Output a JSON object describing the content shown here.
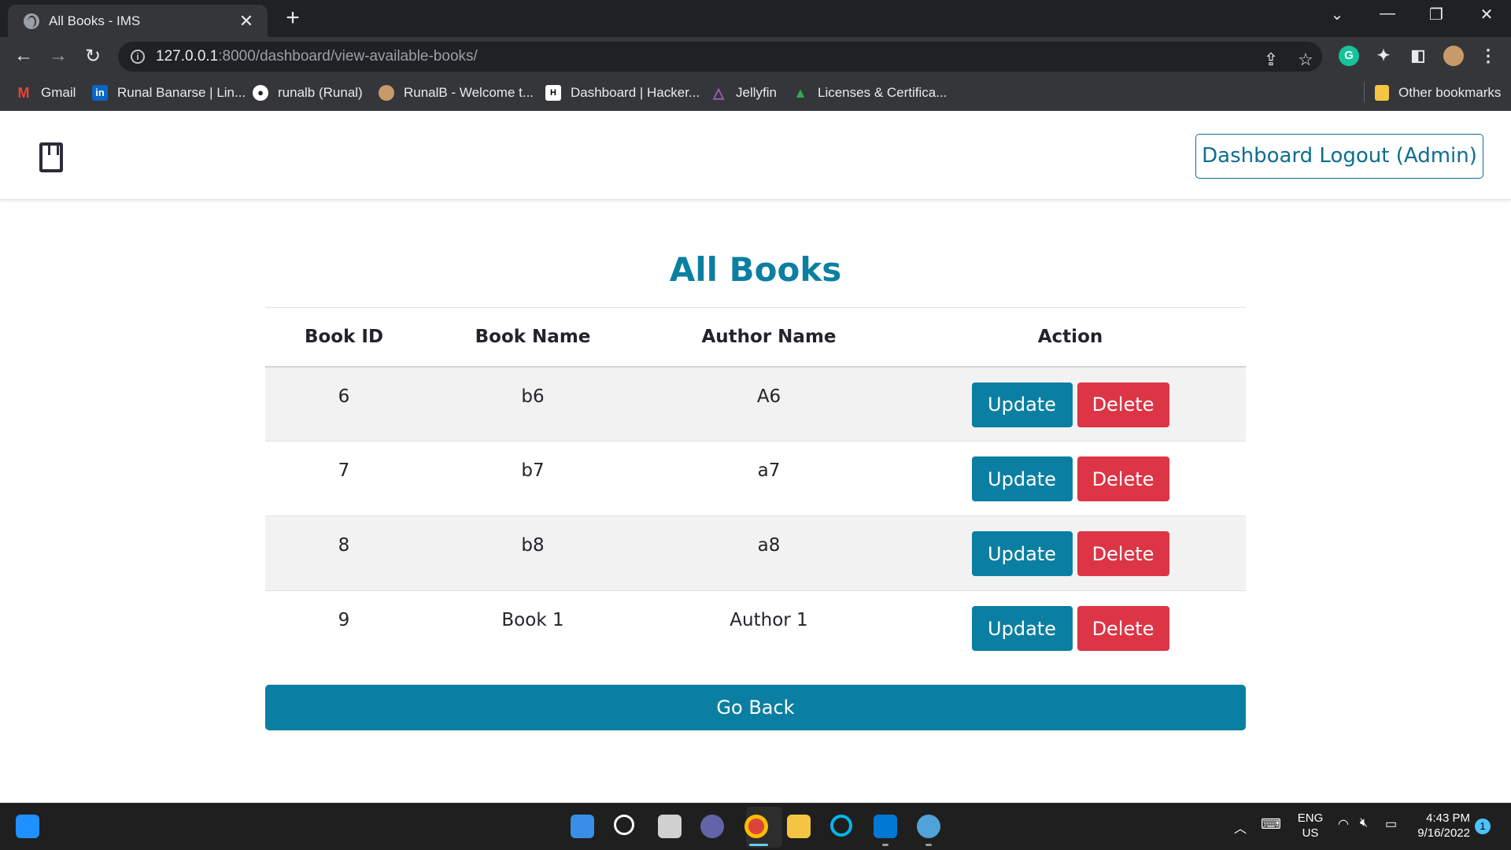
{
  "browser": {
    "tab_title": "All Books - IMS",
    "close_glyph": "✕",
    "new_tab_glyph": "+",
    "url_host": "127.0.0.1",
    "url_path": ":8000/dashboard/view-available-books/",
    "bookmarks": [
      {
        "label": "Gmail",
        "icon": "gmail-icon",
        "color": "#ea4335"
      },
      {
        "label": "Runal Banarse | Lin...",
        "icon": "linkedin-icon",
        "color": "#0a66c2"
      },
      {
        "label": "runalb (Runal)",
        "icon": "github-icon",
        "color": "#ffffff"
      },
      {
        "label": "RunalB - Welcome t...",
        "icon": "avatar-icon",
        "color": "#c89a6a"
      },
      {
        "label": "Dashboard | Hacker...",
        "icon": "hackerrank-icon",
        "color": "#ffffff"
      },
      {
        "label": "Jellyfin",
        "icon": "jellyfin-icon",
        "color": "#aa5cc3"
      },
      {
        "label": "Licenses & Certifica...",
        "icon": "google-drive-icon",
        "color": "#34a853"
      }
    ],
    "other_bookmarks": "Other bookmarks"
  },
  "page": {
    "logout_label": "Dashboard Logout (Admin)",
    "title": "All Books",
    "columns": [
      "Book ID",
      "Book Name",
      "Author Name",
      "Action"
    ],
    "rows": [
      {
        "id": "6",
        "name": "b6",
        "author": "A6"
      },
      {
        "id": "7",
        "name": "b7",
        "author": "a7"
      },
      {
        "id": "8",
        "name": "b8",
        "author": "a8"
      },
      {
        "id": "9",
        "name": "Book 1",
        "author": "Author 1"
      }
    ],
    "update_label": "Update",
    "delete_label": "Delete",
    "go_back_label": "Go Back",
    "accent_color": "#0b7fa2",
    "danger_color": "#dc3545"
  },
  "taskbar": {
    "lang_top": "ENG",
    "lang_bottom": "US",
    "time": "4:43 PM",
    "date": "9/16/2022",
    "notification_count": "1"
  }
}
